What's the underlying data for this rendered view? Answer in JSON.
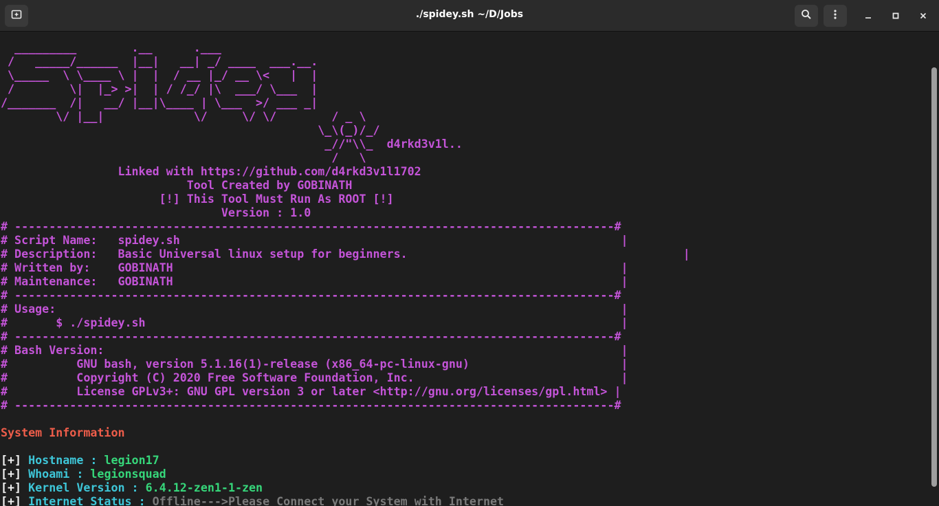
{
  "window": {
    "title": "./spidey.sh ~/D/Jobs"
  },
  "toolbar": {
    "new_tab_icon": "new-tab-icon",
    "search_icon": "search-icon",
    "menu_icon": "kebab-menu-icon",
    "minimize_icon": "minimize-icon",
    "maximize_icon": "maximize-icon",
    "close_icon": "close-icon"
  },
  "terminal": {
    "banner": [
      "  _________        .__      .___",
      " /   _____/______  |__|   __| _/ ____  ___.__.",
      " \\_____  \\ \\____ \\ |  |  / __ |_/ __ \\<   |  |",
      " /        \\|  |_> >|  | / /_/ |\\  ___/ \\___  |",
      "/_______  /|   __/ |__|\\____ | \\___  >/ ___ _|",
      "        \\/ |__|             \\/     \\/ \\/        / _ \\",
      "                                              \\_\\(_)/_/",
      "                                               _//\"\\\\_  d4rkd3v1l..",
      "                                                /   \\"
    ],
    "info_lines": [
      "                 Linked with https://github.com/d4rkd3v1l1702",
      "                           Tool Created by GOBINATH",
      "                       [!] This Tool Must Run As ROOT [!]",
      "                                Version : 1.0"
    ],
    "header_box": [
      "# ---------------------------------------------------------------------------------------#",
      "# Script Name:   spidey.sh                                                                |",
      "# Description:   Basic Universal linux setup for beginners.                                        |",
      "# Written by:    GOBINATH                                                                 |",
      "# Maintenance:   GOBINATH                                                                 |",
      "# ---------------------------------------------------------------------------------------#",
      "# Usage:                                                                                  |",
      "#       $ ./spidey.sh                                                                     |",
      "# ---------------------------------------------------------------------------------------#",
      "# Bash Version:                                                                           |",
      "#          GNU bash, version 5.1.16(1)-release (x86_64-pc-linux-gnu)                      |",
      "#          Copyright (C) 2020 Free Software Foundation, Inc.                              |",
      "#          License GPLv3+: GNU GPL version 3 or later <http://gnu.org/licenses/gpl.html> |",
      "# ---------------------------------------------------------------------------------------#"
    ],
    "section_title": "System Information",
    "bullet": "[+]",
    "system_info": [
      {
        "label": "Hostname : ",
        "value": "legion17"
      },
      {
        "label": "Whoami : ",
        "value": "legionsquad"
      },
      {
        "label": "Kernel Version : ",
        "value": "6.4.12-zen1-1-zen"
      },
      {
        "label": "Internet Status : ",
        "value": "Offline--->Please Connect your System with Internet"
      }
    ]
  },
  "colors": {
    "background": "#1e1e1e",
    "magenta": "#c454d8",
    "section_red": "#ee5d4a",
    "label_cyan": "#3ec6d8",
    "value_green": "#36d67a",
    "offline_gray": "#7a7a7a"
  }
}
